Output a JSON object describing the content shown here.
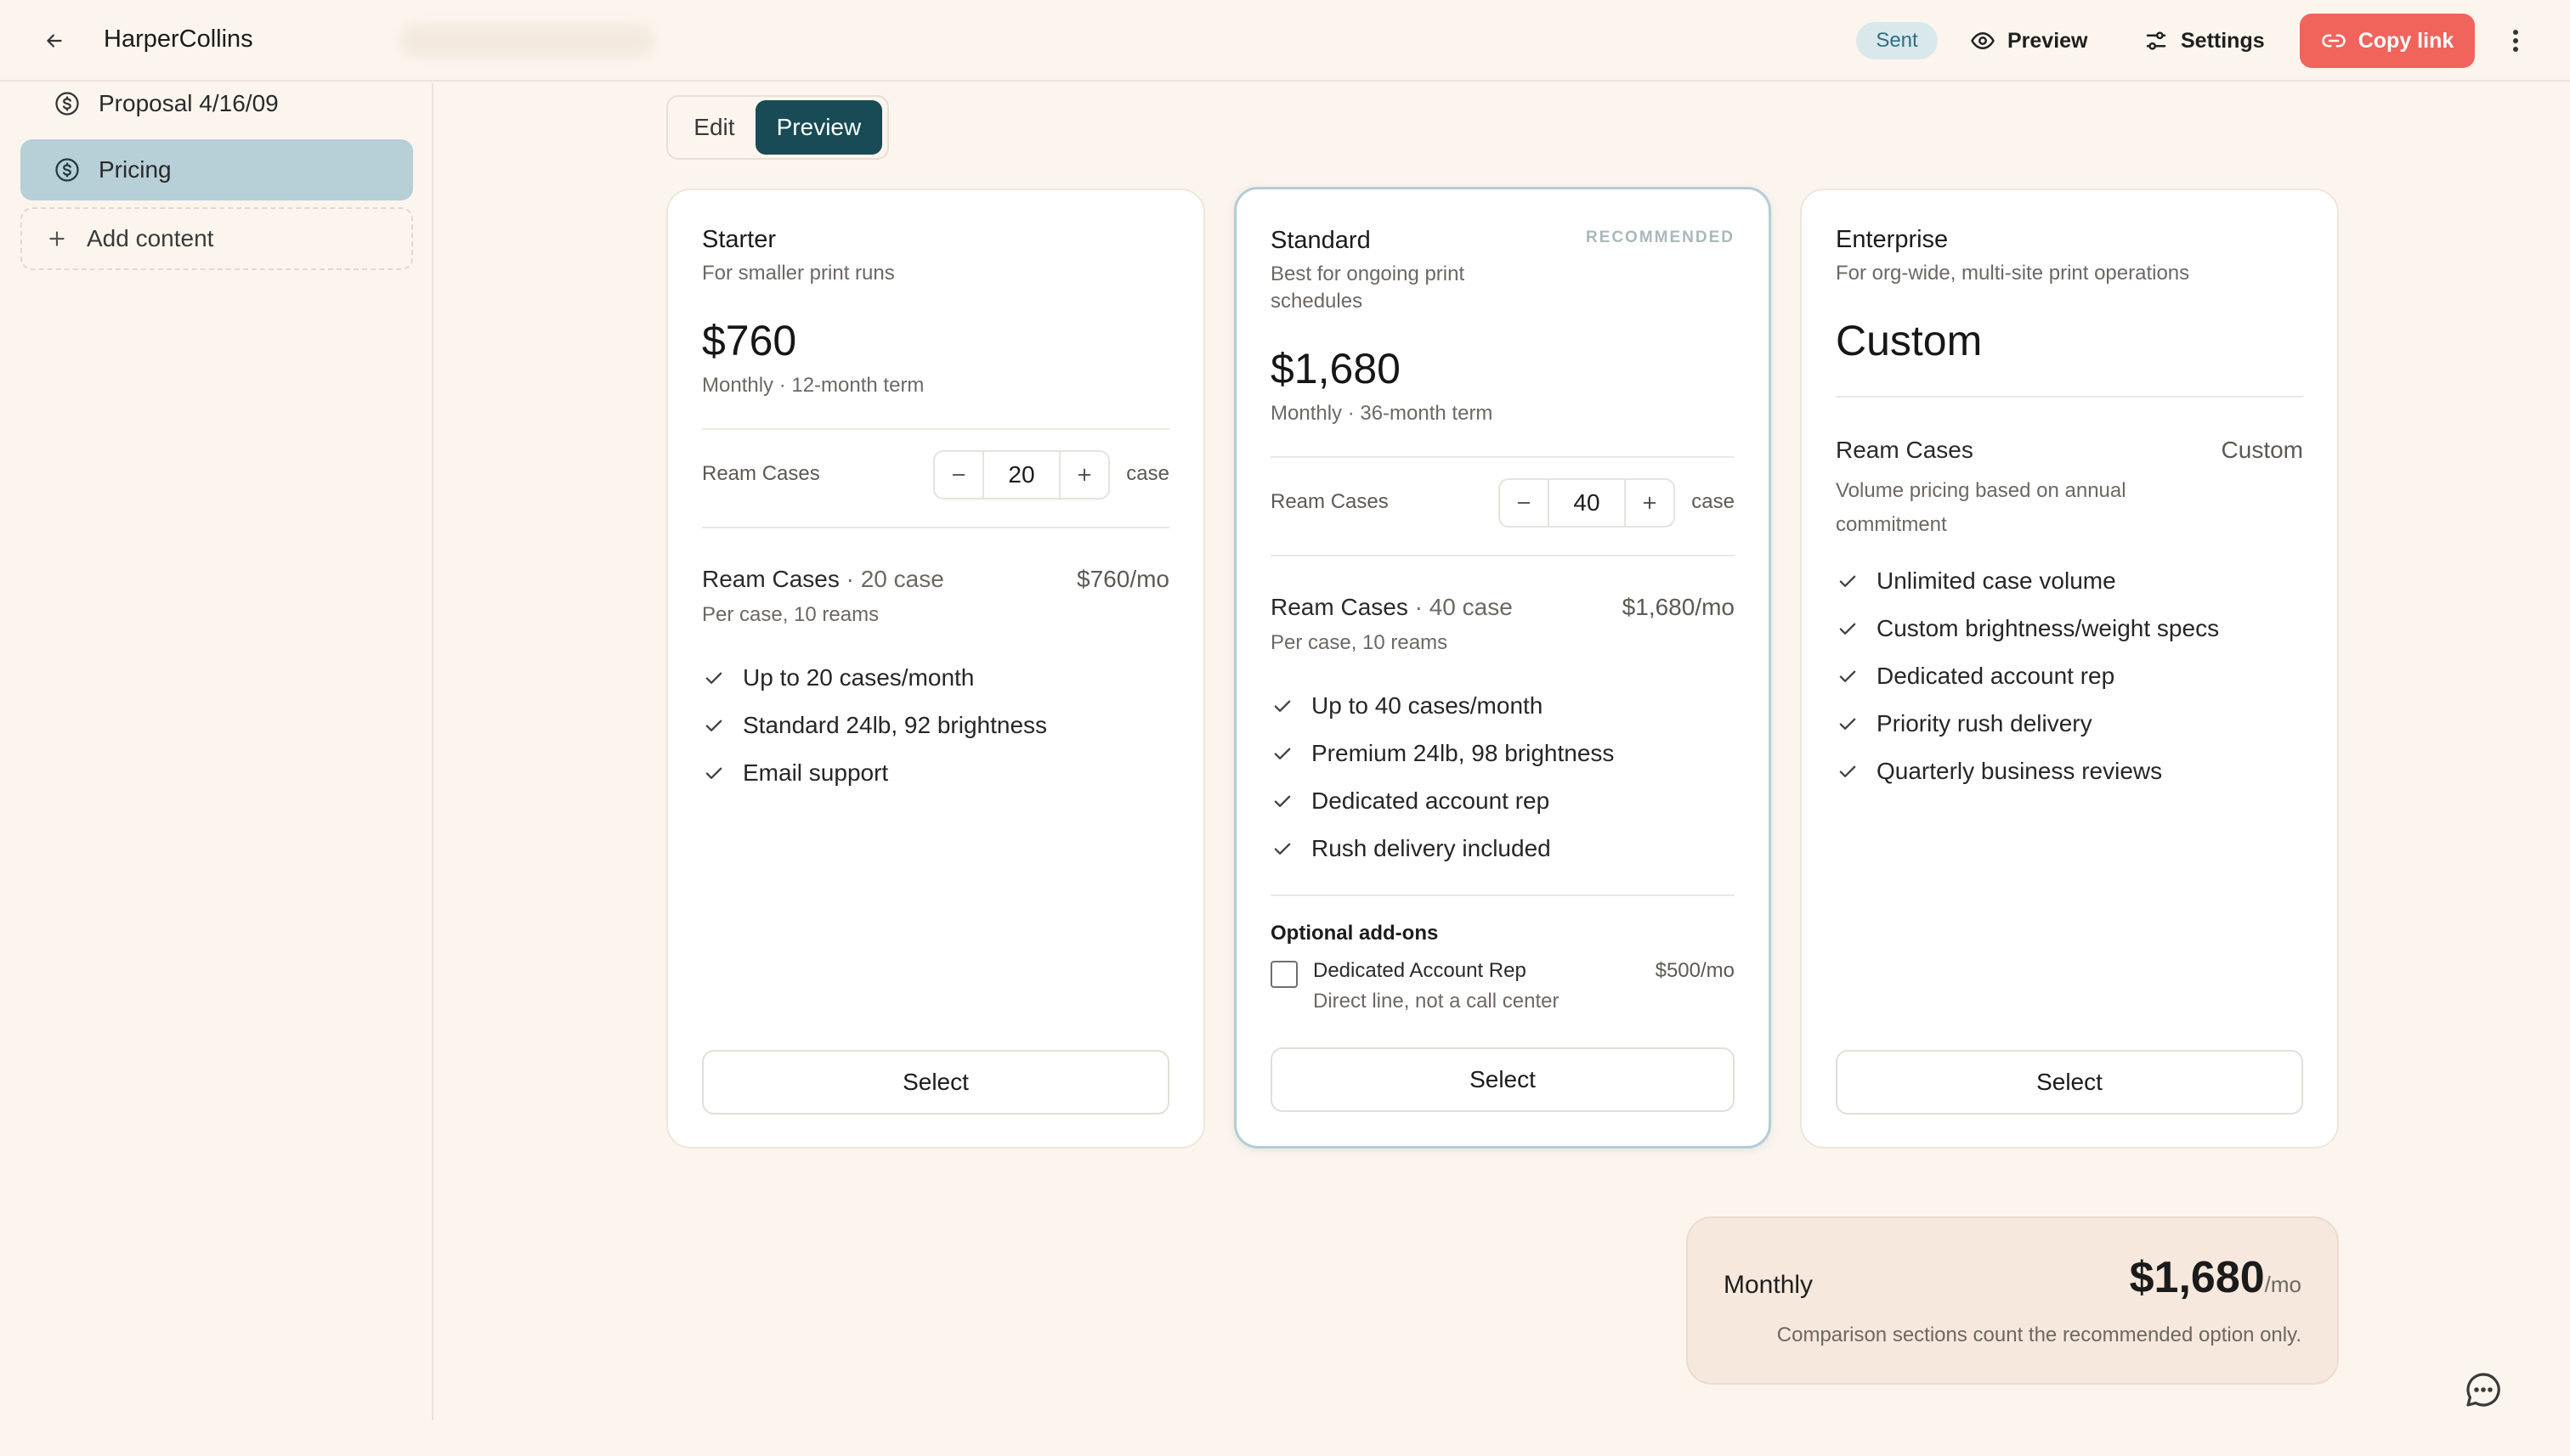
{
  "app": {
    "brand": "HarperCollins",
    "status_badge": "Sent",
    "preview_label": "Preview",
    "settings_label": "Settings",
    "copy_link_label": "Copy link",
    "icons": {
      "back": "arrow-left-icon",
      "preview": "eye-icon",
      "settings": "sliders-icon",
      "copy": "link-icon",
      "more": "kebab-icon",
      "chat": "chat-bubble-icon"
    }
  },
  "sidebar": {
    "items": [
      {
        "label": "Proposal 4/16/09",
        "icon": "dollar-circle-icon",
        "active": false
      },
      {
        "label": "Pricing",
        "icon": "dollar-circle-icon",
        "active": true
      }
    ],
    "add_label": "Add content"
  },
  "mode_toggle": {
    "edit": "Edit",
    "preview": "Preview",
    "selected": "preview"
  },
  "plans": {
    "starter": {
      "name": "Starter",
      "subtitle": "For smaller print runs",
      "price": "$760",
      "term": "Monthly · 12-month term",
      "qty_label": "Ream Cases",
      "qty_value": "20",
      "qty_unit": "case",
      "line_title": "Ream Cases",
      "line_qty": "· 20 case",
      "line_price": "$760/mo",
      "line_sub": "Per case, 10 reams",
      "features": [
        "Up to 20 cases/month",
        "Standard 24lb, 92 brightness",
        "Email support"
      ],
      "select_label": "Select"
    },
    "standard": {
      "name": "Standard",
      "badge": "RECOMMENDED",
      "subtitle_line1": "Best for ongoing print",
      "subtitle_line2": "schedules",
      "price": "$1,680",
      "term": "Monthly · 36-month term",
      "qty_label": "Ream Cases",
      "qty_value": "40",
      "qty_unit": "case",
      "line_title": "Ream Cases",
      "line_qty": "· 40 case",
      "line_price": "$1,680/mo",
      "line_sub": "Per case, 10 reams",
      "features": [
        "Up to 40 cases/month",
        "Premium 24lb, 98 brightness",
        "Dedicated account rep",
        "Rush delivery included"
      ],
      "addons_title": "Optional add-ons",
      "addon": {
        "name": "Dedicated Account Rep",
        "desc": "Direct line, not a call center",
        "price": "$500/mo",
        "checked": false
      },
      "select_label": "Select"
    },
    "enterprise": {
      "name": "Enterprise",
      "subtitle": "For org-wide, multi-site print operations",
      "price": "Custom",
      "line_title": "Ream Cases",
      "line_price": "Custom",
      "line_sub_1": "Volume pricing based on annual",
      "line_sub_2": "commitment",
      "features": [
        "Unlimited case volume",
        "Custom brightness/weight specs",
        "Dedicated account rep",
        "Priority rush delivery",
        "Quarterly business reviews"
      ],
      "select_label": "Select"
    }
  },
  "summary": {
    "label": "Monthly",
    "price": "$1,680",
    "per": "/mo",
    "note": "Comparison sections count the recommended option only."
  },
  "colors": {
    "accent": "#f0645c",
    "toggle_active": "#184b55",
    "sidebar_active": "#b7cfd6",
    "background": "#fcf5ee"
  }
}
